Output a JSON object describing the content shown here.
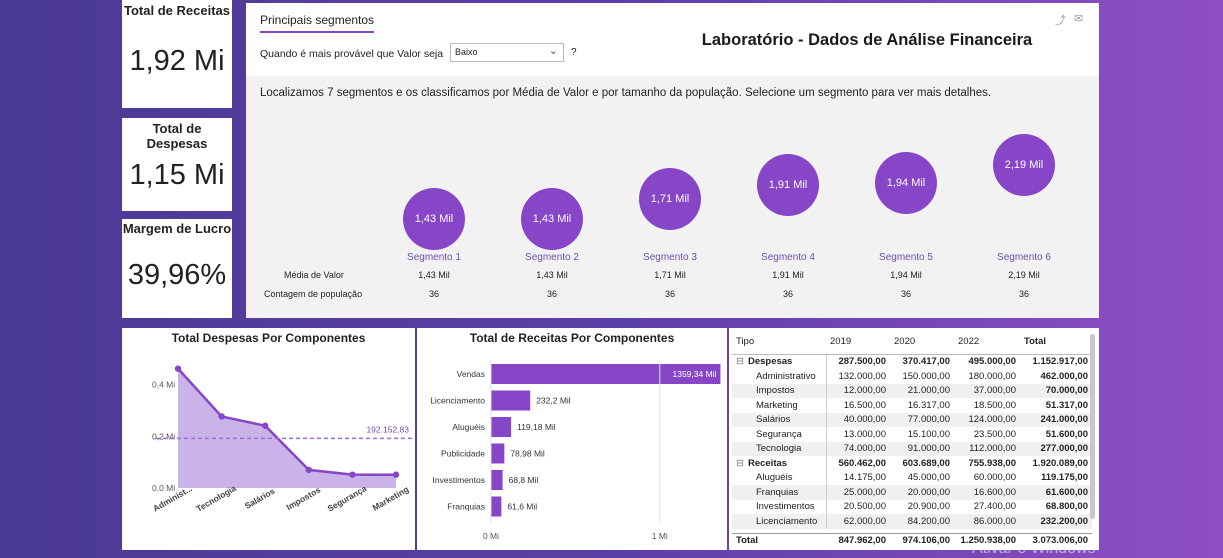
{
  "kpis": [
    {
      "title": "Total de Receitas",
      "value": "1,92 Mi"
    },
    {
      "title": "Total de Despesas",
      "value": "1,15 Mi"
    },
    {
      "title": "Margem de Lucro",
      "value": "39,96%"
    }
  ],
  "segments_panel": {
    "tab_label": "Principais segmentos",
    "dashboard_title": "Laboratório - Dados de Análise Financeira",
    "question_label": "Quando é mais provável que Valor seja",
    "dropdown_value": "Baixo",
    "help_glyph": "?",
    "description": "Localizamos 7 segmentos e os classificamos por Média de Valor e por tamanho da população. Selecione um segmento para ver mais detalhes.",
    "row_labels": [
      "Média de Valor",
      "Contagem de população"
    ],
    "segments": [
      {
        "name": "Segmento 1",
        "bubble": "1,43 Mil",
        "media": "1,43 Mil",
        "contagem": "36",
        "level": 1.43
      },
      {
        "name": "Segmento 2",
        "bubble": "1,43 Mil",
        "media": "1,43 Mil",
        "contagem": "36",
        "level": 1.43
      },
      {
        "name": "Segmento 3",
        "bubble": "1,71 Mil",
        "media": "1,71 Mil",
        "contagem": "36",
        "level": 1.71
      },
      {
        "name": "Segmento 4",
        "bubble": "1,91 Mil",
        "media": "1,91 Mil",
        "contagem": "36",
        "level": 1.91
      },
      {
        "name": "Segmento 5",
        "bubble": "1,94 Mil",
        "media": "1,94 Mil",
        "contagem": "36",
        "level": 1.94
      },
      {
        "name": "Segmento 6",
        "bubble": "2,19 Mil",
        "media": "2,19 Mil",
        "contagem": "36",
        "level": 2.19
      }
    ]
  },
  "chart_data": [
    {
      "type": "area",
      "title": "Total Despesas Por Componentes",
      "categories": [
        "Administrativo",
        "Tecnologia",
        "Salários",
        "Impostos",
        "Segurança",
        "Marketing"
      ],
      "values": [
        462000,
        277000,
        241000,
        70000,
        51600,
        51317
      ],
      "average_line": 192152.83,
      "average_label": "192.152,83",
      "ylim": [
        0,
        480000
      ],
      "y_ticks": [
        {
          "v": 0,
          "label": "0,0 Mi"
        },
        {
          "v": 200000,
          "label": "0,2 Mi"
        },
        {
          "v": 400000,
          "label": "0,4 Mi"
        }
      ],
      "x_tick_labels": [
        "Administ...",
        "Tecnologia",
        "Salários",
        "Impostos",
        "Segurança",
        "Marketing"
      ],
      "color": "#8646c7"
    },
    {
      "type": "bar",
      "title": "Total de Receitas Por Componentes",
      "categories": [
        "Vendas",
        "Licenciamento",
        "Aluguéis",
        "Publicidade",
        "Investimentos",
        "Franquias"
      ],
      "values": [
        1359340,
        232200,
        119180,
        78980,
        68800,
        61600
      ],
      "value_labels": [
        "1359,34 Mil",
        "232,2 Mil",
        "119,18 Mil",
        "78,98 Mil",
        "68,8 Mil",
        "61,6 Mil"
      ],
      "xlim": [
        0,
        1250000
      ],
      "x_ticks": [
        {
          "v": 0,
          "label": "0 Mi"
        },
        {
          "v": 1000000,
          "label": "1 Mi"
        }
      ],
      "color": "#8646c7"
    }
  ],
  "matrix": {
    "headers": [
      "Tipo",
      "2019",
      "2020",
      "2022",
      "Total"
    ],
    "rows": [
      {
        "group": true,
        "label": "Despesas",
        "toggle": "⊟",
        "vals": [
          "287.500,00",
          "370.417,00",
          "495.000,00",
          "1.152.917,00"
        ]
      },
      {
        "label": "Administrativo",
        "vals": [
          "132.000,00",
          "150.000,00",
          "180.000,00",
          "462.000,00"
        ]
      },
      {
        "label": "Impostos",
        "vals": [
          "12.000,00",
          "21.000,00",
          "37.000,00",
          "70.000,00"
        ]
      },
      {
        "label": "Marketing",
        "vals": [
          "16.500,00",
          "16.317,00",
          "18.500,00",
          "51.317,00"
        ]
      },
      {
        "label": "Salários",
        "vals": [
          "40.000,00",
          "77.000,00",
          "124.000,00",
          "241.000,00"
        ]
      },
      {
        "label": "Segurança",
        "vals": [
          "13.000,00",
          "15.100,00",
          "23.500,00",
          "51.600,00"
        ]
      },
      {
        "label": "Tecnologia",
        "vals": [
          "74.000,00",
          "91.000,00",
          "112.000,00",
          "277.000,00"
        ]
      },
      {
        "group": true,
        "label": "Receitas",
        "toggle": "⊟",
        "vals": [
          "560.462,00",
          "603.689,00",
          "755.938,00",
          "1.920.089,00"
        ]
      },
      {
        "label": "Aluguéis",
        "vals": [
          "14.175,00",
          "45.000,00",
          "60.000,00",
          "119.175,00"
        ]
      },
      {
        "label": "Franquias",
        "vals": [
          "25.000,00",
          "20.000,00",
          "16.600,00",
          "61.600,00"
        ]
      },
      {
        "label": "Investimentos",
        "vals": [
          "20.500,00",
          "20.900,00",
          "27.400,00",
          "68.800,00"
        ]
      },
      {
        "label": "Licenciamento",
        "vals": [
          "62.000,00",
          "84.200,00",
          "86.000,00",
          "232.200,00"
        ]
      }
    ],
    "total_row": {
      "label": "Total",
      "vals": [
        "847.962,00",
        "974.106,00",
        "1.250.938,00",
        "3.073.006,00"
      ]
    }
  },
  "watermark": "Ativar o Windows",
  "colors": {
    "accent": "#8646c7",
    "segment_text": "#6b4fb0",
    "bar_light": "#c9b3e8"
  }
}
